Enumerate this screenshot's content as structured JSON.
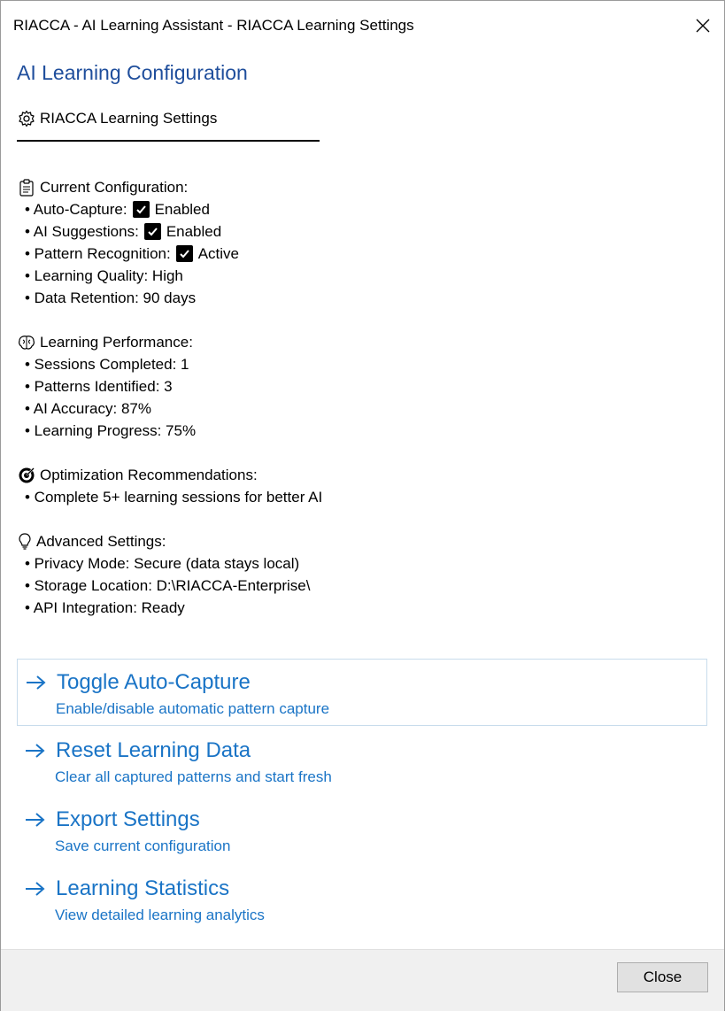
{
  "window": {
    "title": "RIACCA - AI Learning Assistant - RIACCA Learning Settings"
  },
  "heading": "AI Learning Configuration",
  "settings_header": "RIACCA Learning Settings",
  "sections": {
    "current": {
      "title": "Current Configuration:",
      "items": {
        "auto_capture_label": "• Auto-Capture:",
        "auto_capture_value": "Enabled",
        "ai_suggestions_label": "• AI Suggestions:",
        "ai_suggestions_value": "Enabled",
        "pattern_recognition_label": "• Pattern Recognition:",
        "pattern_recognition_value": "Active",
        "learning_quality": "• Learning Quality: High",
        "data_retention": "• Data Retention: 90 days"
      }
    },
    "performance": {
      "title": "Learning Performance:",
      "items": [
        "• Sessions Completed: 1",
        "• Patterns Identified: 3",
        "• AI Accuracy: 87%",
        "• Learning Progress: 75%"
      ]
    },
    "optimization": {
      "title": "Optimization Recommendations:",
      "items": [
        "• Complete 5+ learning sessions for better AI"
      ]
    },
    "advanced": {
      "title": "Advanced Settings:",
      "items": [
        "• Privacy Mode: Secure (data stays local)",
        "• Storage Location: D:\\RIACCA-Enterprise\\",
        "• API Integration: Ready"
      ]
    }
  },
  "actions": [
    {
      "title": "Toggle Auto-Capture",
      "description": "Enable/disable automatic pattern capture"
    },
    {
      "title": "Reset Learning Data",
      "description": "Clear all captured patterns and start fresh"
    },
    {
      "title": "Export Settings",
      "description": "Save current configuration"
    },
    {
      "title": "Learning Statistics",
      "description": "View detailed learning analytics"
    }
  ],
  "footer": {
    "close_label": "Close"
  },
  "icons": {
    "settings": "gear-icon",
    "current": "clipboard-icon",
    "performance": "brain-icon",
    "optimization": "target-icon",
    "advanced": "lightbulb-icon",
    "checkbox": "checkmark-icon",
    "action_arrow": "arrow-right-icon"
  },
  "colors": {
    "heading": "#1f4e9c",
    "link": "#1a74c6"
  }
}
